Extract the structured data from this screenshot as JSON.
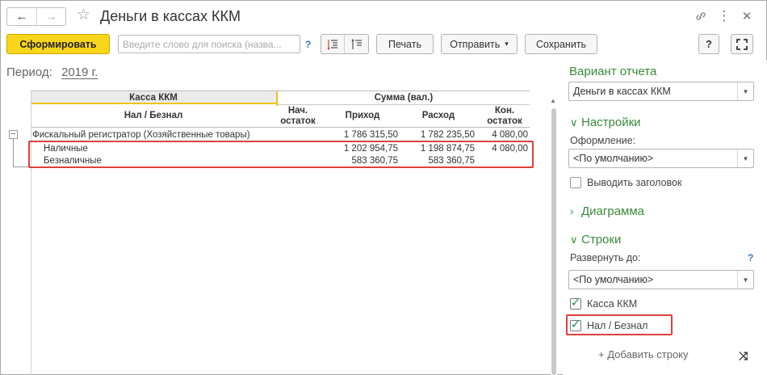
{
  "window": {
    "title": "Деньги в кассах ККМ",
    "back_icon": "←",
    "forward_icon": "→",
    "star_icon": "☆",
    "link_icon": "🔗",
    "menu_icon": "⋮",
    "close_icon": "✕"
  },
  "toolbar": {
    "generate_label": "Сформировать",
    "search_placeholder": "Введите слово для поиска (назва...",
    "help_mark": "?",
    "print_label": "Печать",
    "send_label": "Отправить",
    "send_arrow": "▾",
    "save_label": "Сохранить",
    "help_button": "?",
    "fullscreen_icon": "⛶"
  },
  "period": {
    "label": "Период:",
    "value": "2019 г."
  },
  "report": {
    "group_header": "Касса ККМ",
    "sum_header": "Сумма (вал.)",
    "subgroup_header": "Нал / Безнал",
    "columns": {
      "start": "Нач.\nостаток",
      "start_l1": "Нач.",
      "start_l2": "остаток",
      "income": "Приход",
      "expense": "Расход",
      "end_l1": "Кон.",
      "end_l2": "остаток"
    },
    "rows": [
      {
        "name": "Фискальный регистратор (Хозяйственные товары)",
        "start": "",
        "income": "1 786 315,50",
        "expense": "1 782 235,50",
        "end": "4 080,00"
      },
      {
        "name": "Наличные",
        "start": "",
        "income": "1 202 954,75",
        "expense": "1 198 874,75",
        "end": "4 080,00"
      },
      {
        "name": "Безналичные",
        "start": "",
        "income": "583 360,75",
        "expense": "583 360,75",
        "end": ""
      }
    ],
    "collapse_icon": "−"
  },
  "panel": {
    "variant_title": "Вариант отчета",
    "variant_value": "Деньги в кассах ККМ",
    "settings_title": "Настройки",
    "design_label": "Оформление:",
    "design_value": "<По умолчанию>",
    "show_header_label": "Выводить заголовок",
    "show_header_checked": false,
    "chart_title": "Диаграмма",
    "rows_title": "Строки",
    "expand_label": "Развернуть до:",
    "expand_help": "?",
    "expand_value": "<По умолчанию>",
    "row_items": [
      {
        "label": "Касса ККМ",
        "checked": true
      },
      {
        "label": "Нал / Безнал",
        "checked": true
      }
    ],
    "add_row_label": "+ Добавить строку",
    "shuffle_icon": "⤨",
    "accent_color": "#3a8a3a",
    "highlight_color": "#e0403b",
    "primary_button_color": "#f9d61b"
  }
}
